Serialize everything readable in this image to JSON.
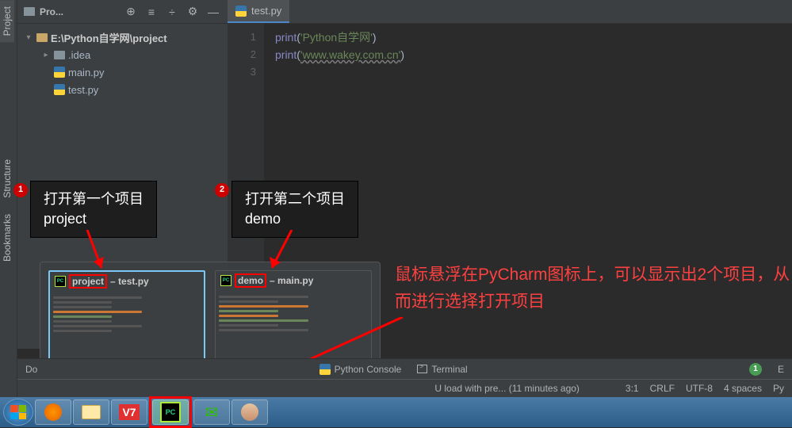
{
  "left_stripe": {
    "project": "Project",
    "structure": "Structure",
    "bookmarks": "Bookmarks"
  },
  "project_panel": {
    "title": "Pro...",
    "root": "E:\\Python自学网\\project",
    "folder1": ".idea",
    "file1": "main.py",
    "file2": "test.py"
  },
  "editor": {
    "tab": "test.py",
    "gutter": [
      "1",
      "2",
      "3"
    ],
    "line1_fn": "print",
    "line1_str": "'Python自学网'",
    "line2_fn": "print",
    "line2_str": "'www.wakey.com.cn'"
  },
  "callouts": {
    "c1_num": "1",
    "c1_l1": "打开第一个项目",
    "c1_l2": "project",
    "c2_num": "2",
    "c2_l1": "打开第二个项目",
    "c2_l2": "demo"
  },
  "red_note": "鼠标悬浮在PyCharm图标上，可以显示出2个项目，从而进行选择打开项目",
  "thumbs": {
    "t1_hl": "project",
    "t1_rest": " – test.py",
    "t2_hl": "demo",
    "t2_rest": " – main.py"
  },
  "bottom": {
    "do": "Do",
    "py_console": "Python Console",
    "terminal": "Terminal",
    "e_count": "1",
    "e_label": "E"
  },
  "status": {
    "msg": "U load with pre... (11 minutes ago)",
    "pos": "3:1",
    "crlf": "CRLF",
    "enc": "UTF-8",
    "indent": "4 spaces",
    "py": "Py"
  },
  "taskbar": {
    "pycharm": "PC"
  }
}
